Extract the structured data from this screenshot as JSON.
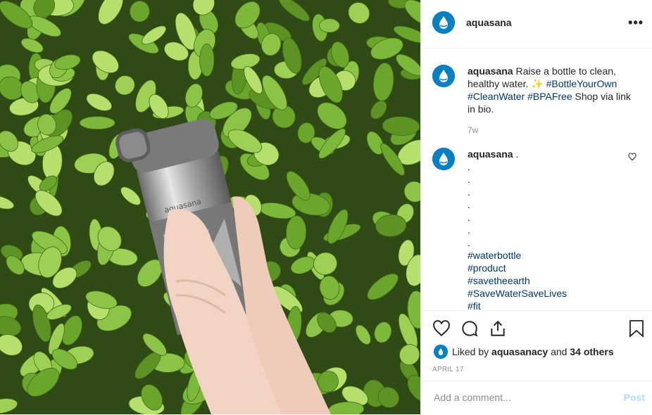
{
  "post": {
    "username": "aquasana",
    "caption_text": "Raise a bottle to clean, healthy water.",
    "caption_tags": [
      "#BottleYourOwn",
      "#CleanWater",
      "#BPAFree"
    ],
    "caption_tail": "Shop via link in bio.",
    "caption_time": "7w",
    "bottle_brand": "aquasana"
  },
  "comment": {
    "username": "aquasana",
    "text": ".",
    "dots": [
      ".",
      ".",
      ".",
      ".",
      ".",
      ".",
      "."
    ],
    "tags": [
      "#waterbottle",
      "#product",
      "#savetheearth",
      "#SaveWaterSaveLives",
      "#fit"
    ]
  },
  "likes": {
    "prefix": "Liked by",
    "user": "aquasanacy",
    "middle": "and",
    "others": "34 others"
  },
  "date": "APRIL 17",
  "add_comment": {
    "placeholder": "Add a comment...",
    "post_label": "Post"
  },
  "more_label": "•••",
  "colors": {
    "tag": "#00376b",
    "post_button": "#b3dbff",
    "brand_blue": "#0a7fc2"
  }
}
